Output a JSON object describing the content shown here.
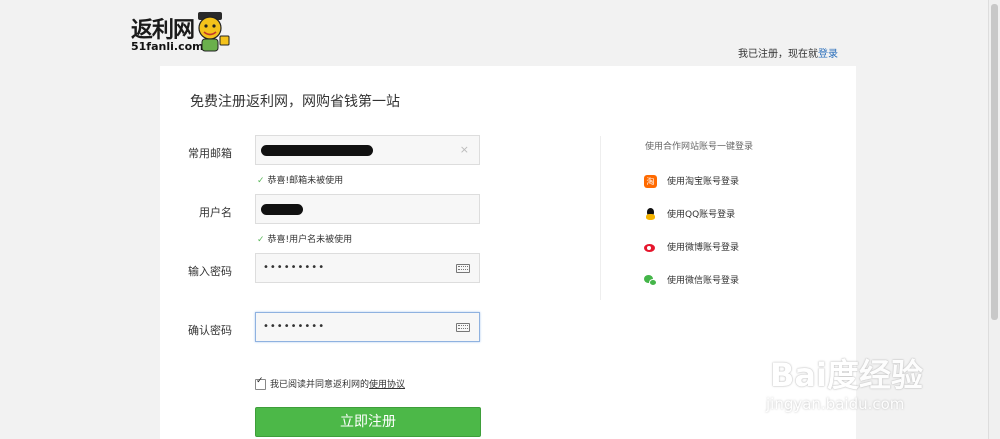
{
  "header": {
    "logo_text": "返利网",
    "logo_domain": "51fanli.com",
    "login_prompt": "我已注册，现在就",
    "login_link": "登录"
  },
  "form": {
    "title": "免费注册返利网，网购省钱第一站",
    "email_label": "常用邮箱",
    "email_clear_icon": "×",
    "email_ok": "恭喜!邮箱未被使用",
    "username_label": "用户名",
    "username_ok": "恭喜!用户名未被使用",
    "password_label": "输入密码",
    "password_value": "•••••••••",
    "confirm_label": "确认密码",
    "confirm_value": "•••••••••",
    "agree_text": "我已阅读并同意返利网的",
    "agree_link": "使用协议",
    "agree_checked": true,
    "submit_label": "立即注册"
  },
  "partners": {
    "title": "使用合作网站账号一键登录",
    "items": [
      {
        "label": "使用淘宝账号登录",
        "icon": "taobao-icon"
      },
      {
        "label": "使用QQ账号登录",
        "icon": "qq-icon"
      },
      {
        "label": "使用微博账号登录",
        "icon": "weibo-icon"
      },
      {
        "label": "使用微信账号登录",
        "icon": "wechat-icon"
      }
    ]
  },
  "watermark": {
    "main": "Bai度经验",
    "sub": "jingyan.baidu.com"
  },
  "colors": {
    "accent_green": "#4cb848",
    "link_blue": "#2a6ebb",
    "check_green": "#5cb85c"
  }
}
